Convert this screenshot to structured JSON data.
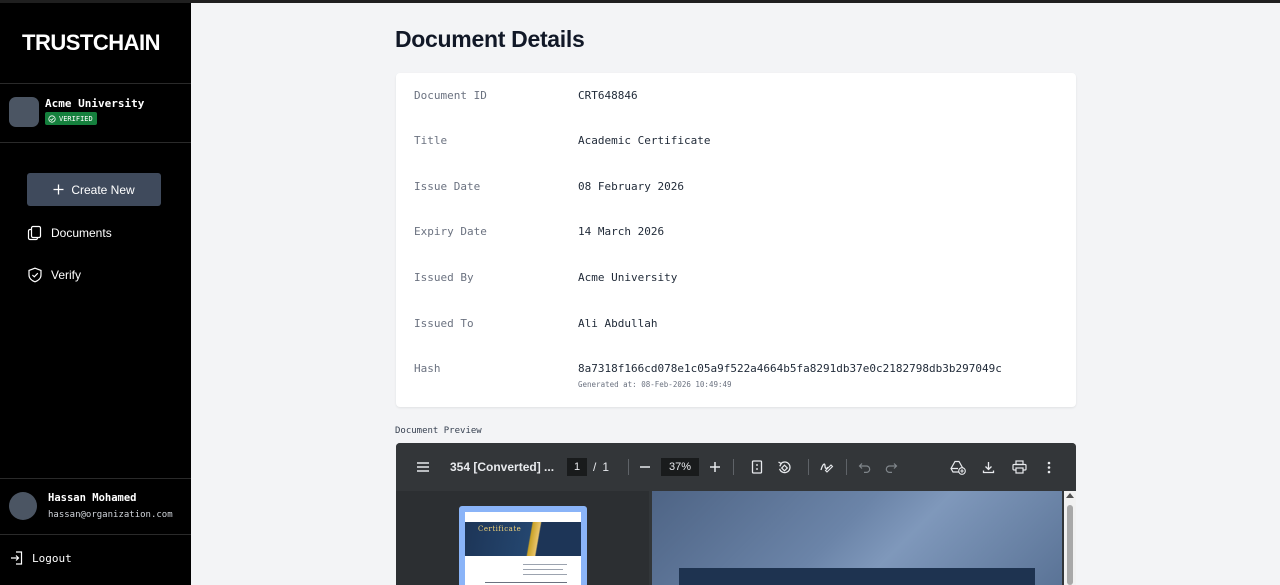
{
  "brand": {
    "logo_text": "TRUSTCHAIN"
  },
  "organization": {
    "name": "Acme University",
    "badge": "VERIFIED",
    "badge_color": "#15803d"
  },
  "sidebar": {
    "create_label": "Create New",
    "items": [
      {
        "label": "Documents",
        "icon": "documents-icon"
      },
      {
        "label": "Verify",
        "icon": "shield-check-icon"
      }
    ]
  },
  "user": {
    "name": "Hassan Mohamed",
    "email": "hassan@organization.com",
    "logout_label": "Logout"
  },
  "page": {
    "title": "Document Details"
  },
  "details": [
    {
      "label": "Document ID",
      "value": "CRT648846"
    },
    {
      "label": "Title",
      "value": "Academic Certificate"
    },
    {
      "label": "Issue Date",
      "value": "08 February 2026"
    },
    {
      "label": "Expiry Date",
      "value": "14 March 2026"
    },
    {
      "label": "Issued By",
      "value": "Acme University"
    },
    {
      "label": "Issued To",
      "value": "Ali Abdullah"
    },
    {
      "label": "Hash",
      "value": "8a7318f166cd078e1c05a9f522a4664b5fa8291db37e0c2182798db3b297049c"
    }
  ],
  "hash_generated": "Generated at: 08-Feb-2026 10:49:49",
  "preview": {
    "label": "Document Preview",
    "viewer": {
      "doc_name": "354 [Converted] ...",
      "current_page": "1",
      "page_separator": "/",
      "total_pages": "1",
      "zoom": "37%",
      "thumbnail_title": "Certificate"
    }
  },
  "colors": {
    "sidebar_bg": "#000000",
    "accent_button": "#3f4a5c",
    "page_bg": "#f3f4f6",
    "viewer_bg": "#323639"
  }
}
